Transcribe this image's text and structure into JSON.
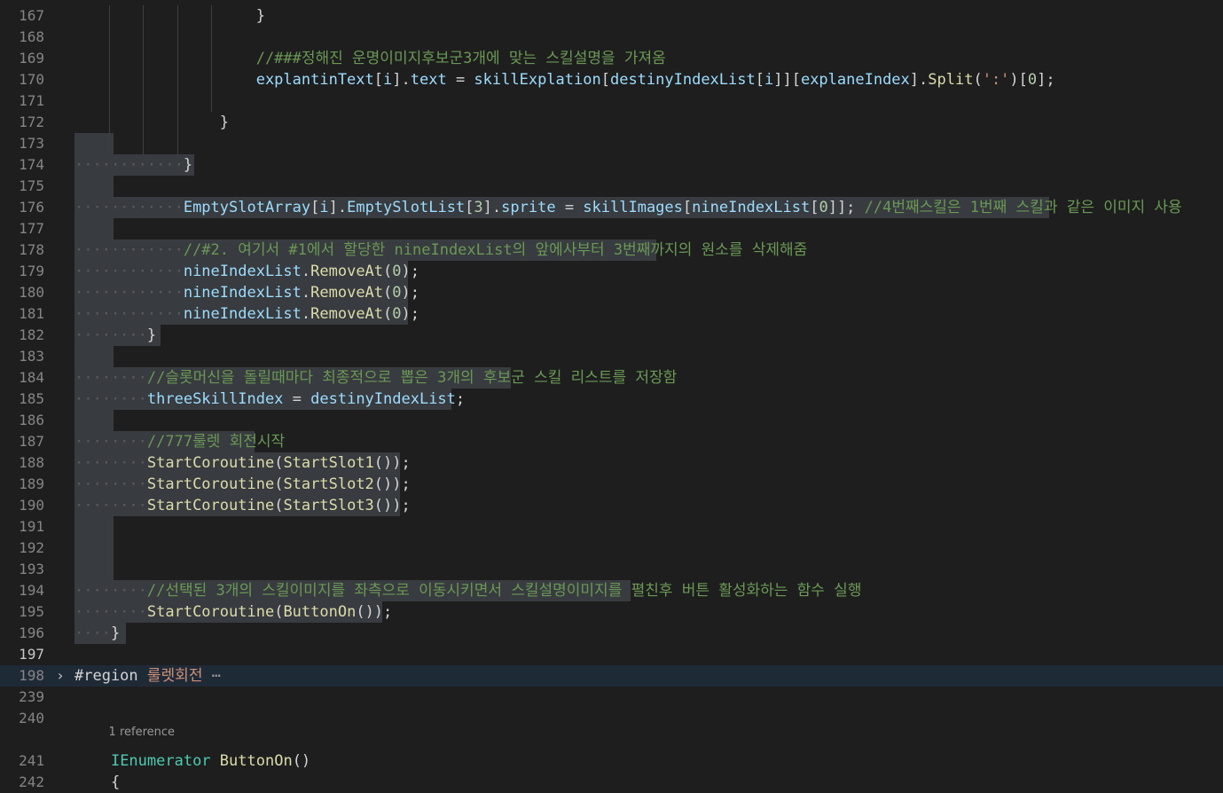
{
  "editor": {
    "active_line": "197",
    "codelens": "1 reference",
    "fold_marker": "⋯",
    "lines": [
      {
        "n": "167",
        "text": "}"
      },
      {
        "n": "168",
        "text": ""
      },
      {
        "n": "169",
        "text": "//###정해진 운명이미지후보군3개에 맞는 스킬설명을 가져옴"
      },
      {
        "n": "170",
        "text": "explantinText[i].text = skillExplation[destinyIndexList[i]][explaneIndex].Split(':')[0];"
      },
      {
        "n": "171",
        "text": ""
      },
      {
        "n": "172",
        "text": "}"
      },
      {
        "n": "173",
        "text": ""
      },
      {
        "n": "174",
        "text": "}"
      },
      {
        "n": "175",
        "text": ""
      },
      {
        "n": "176",
        "text": "EmptySlotArray[i].EmptySlotList[3].sprite = skillImages[nineIndexList[0]]; //4번째스킬은 1번째 스킬과 같은 이미지 사용"
      },
      {
        "n": "177",
        "text": ""
      },
      {
        "n": "178",
        "text": "//#2. 여기서 #1에서 할당한 nineIndexList의 앞에사부터 3번째까지의 원소를 삭제해줌"
      },
      {
        "n": "179",
        "text": "nineIndexList.RemoveAt(0);"
      },
      {
        "n": "180",
        "text": "nineIndexList.RemoveAt(0);"
      },
      {
        "n": "181",
        "text": "nineIndexList.RemoveAt(0);"
      },
      {
        "n": "182",
        "text": "}"
      },
      {
        "n": "183",
        "text": ""
      },
      {
        "n": "184",
        "text": "//슬롯머신을 돌릴때마다 최종적으로 뽑은 3개의 후보군 스킬 리스트를 저장함"
      },
      {
        "n": "185",
        "text": "threeSkillIndex = destinyIndexList;"
      },
      {
        "n": "186",
        "text": ""
      },
      {
        "n": "187",
        "text": "//777룰렛 회전시작"
      },
      {
        "n": "188",
        "text": "StartCoroutine(StartSlot1());"
      },
      {
        "n": "189",
        "text": "StartCoroutine(StartSlot2());"
      },
      {
        "n": "190",
        "text": "StartCoroutine(StartSlot3());"
      },
      {
        "n": "191",
        "text": ""
      },
      {
        "n": "192",
        "text": ""
      },
      {
        "n": "193",
        "text": ""
      },
      {
        "n": "194",
        "text": "//선택된 3개의 스킬이미지를 좌측으로 이동시키면서 스킬설명이미지를 펼친후 버튼 활성화하는 함수 실행"
      },
      {
        "n": "195",
        "text": "StartCoroutine(ButtonOn());"
      },
      {
        "n": "196",
        "text": "}"
      },
      {
        "n": "197",
        "text": ""
      },
      {
        "n": "198",
        "text": "#region 룰렛회전"
      },
      {
        "n": "239",
        "text": ""
      },
      {
        "n": "240",
        "text": ""
      },
      {
        "n": "241",
        "text": "IEnumerator ButtonOn()"
      },
      {
        "n": "242",
        "text": "{"
      }
    ]
  },
  "colors": {
    "background": "#1e1e1e",
    "selection": "#3a3d41",
    "keyword": "#569cd6",
    "type": "#4ec9b0",
    "method": "#dcdcaa",
    "variable": "#9cdcfe",
    "number": "#b5cea8",
    "string": "#ce9178",
    "comment": "#6a9955"
  }
}
